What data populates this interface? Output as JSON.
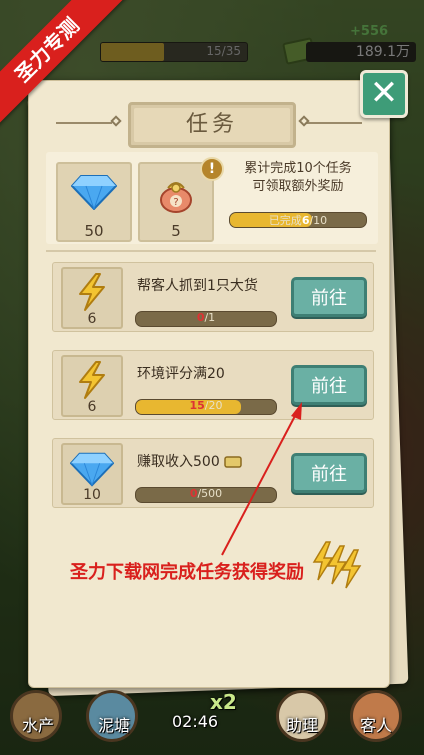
{
  "ribbon_text": "圣力专测",
  "hud": {
    "progress_text": "15/35",
    "progress_fraction": 0.43,
    "money_delta": "+556",
    "money_total": "189.1万"
  },
  "panel": {
    "title": "任务",
    "close_symbol": "✕",
    "rewards": [
      {
        "icon": "diamond-icon",
        "count": "50"
      },
      {
        "icon": "gift-bag-icon",
        "count": "5"
      }
    ],
    "bonus_line1": "累计完成10个任务",
    "bonus_line2": "可领取额外奖励",
    "bonus_bar_prefix": "已完成",
    "bonus_bar_current": "6",
    "bonus_bar_total": "/10",
    "bonus_fraction": 0.6,
    "tasks": [
      {
        "icon": "lightning-icon",
        "reward": "6",
        "desc": "帮客人抓到1只大货",
        "current": "0",
        "total": "/1",
        "fraction": 0,
        "button": "前往"
      },
      {
        "icon": "lightning-icon",
        "reward": "6",
        "desc": "环境评分满20",
        "current": "15",
        "total": "/20",
        "fraction": 0.75,
        "button": "前往"
      },
      {
        "icon": "diamond-icon",
        "reward": "10",
        "desc": "赚取收入500",
        "current": "0",
        "total": "/500",
        "fraction": 0,
        "button": "前往"
      }
    ]
  },
  "watermark": "圣力下载网完成任务获得奖励",
  "bottom_nav": {
    "item1": "水产",
    "item2": "泥塘",
    "timer": "02:46",
    "boost": "x2",
    "item4": "助理",
    "item5": "客人"
  },
  "colors": {
    "accent_green": "#3e9c78",
    "progress_gold": "#e8b730",
    "watermark_red": "#d9201d"
  }
}
